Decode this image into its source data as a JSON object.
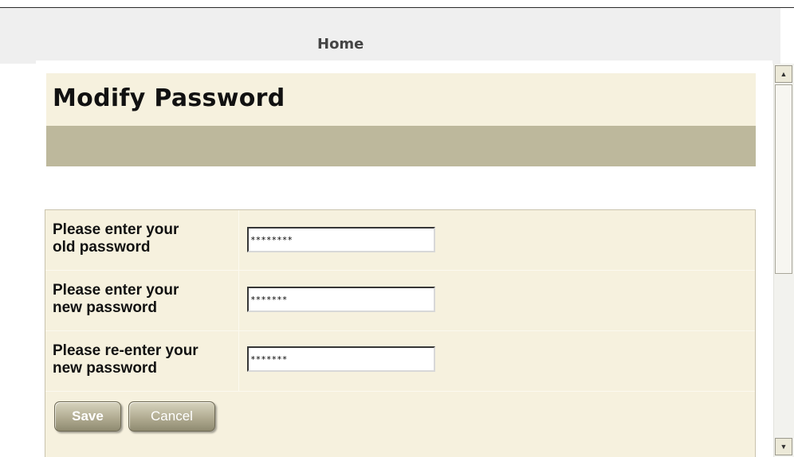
{
  "nav": {
    "home_label": "Home"
  },
  "page": {
    "title": "Modify Password"
  },
  "form": {
    "fields": [
      {
        "label": "Please enter your\nold password",
        "value": "********"
      },
      {
        "label": "Please enter your\nnew password",
        "value": "*******"
      },
      {
        "label": "Please re-enter your\nnew password",
        "value": "*******"
      }
    ],
    "save_label": "Save",
    "cancel_label": "Cancel"
  },
  "scrollbar": {
    "up_icon": "arrow-up-icon",
    "down_icon": "arrow-down-icon"
  }
}
